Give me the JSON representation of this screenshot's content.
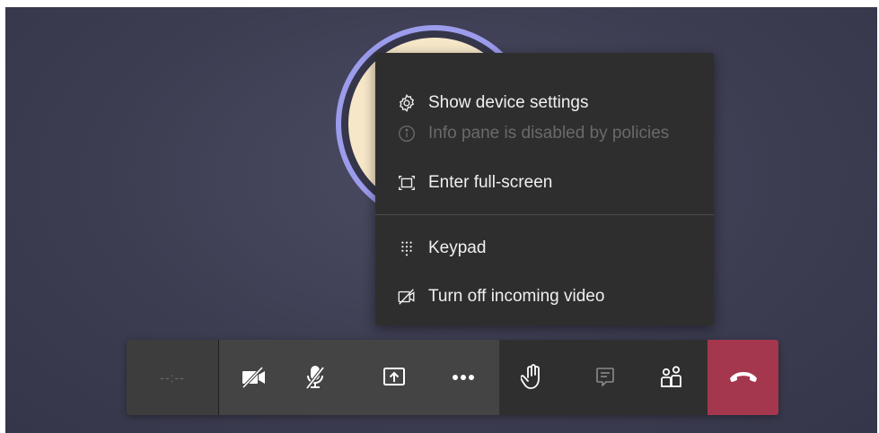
{
  "menu": {
    "items": [
      {
        "label": "Show device settings",
        "icon": "gear-icon",
        "enabled": true
      },
      {
        "label": "Info pane is disabled by policies",
        "icon": "info-icon",
        "enabled": false
      },
      {
        "label": "Enter full-screen",
        "icon": "fullscreen-icon",
        "enabled": true
      },
      {
        "label": "Keypad",
        "icon": "keypad-icon",
        "enabled": true
      },
      {
        "label": "Turn off incoming video",
        "icon": "video-off-icon",
        "enabled": true
      }
    ]
  },
  "toolbar": {
    "timer": "--:--",
    "buttons": [
      "camera-off-icon",
      "mic-off-icon",
      "share-screen-icon",
      "more-options-icon",
      "raise-hand-icon",
      "chat-icon",
      "participants-icon",
      "hang-up-icon"
    ]
  },
  "colors": {
    "background": "#3d3d52",
    "avatar_ring": "#9c9ced",
    "avatar_fill": "#f6e7c8",
    "menu_bg": "#2e2e2e",
    "toolbar_bg": "#2f2f2f",
    "toolbar_mid_bg": "#444444",
    "hangup": "#a4374e"
  }
}
